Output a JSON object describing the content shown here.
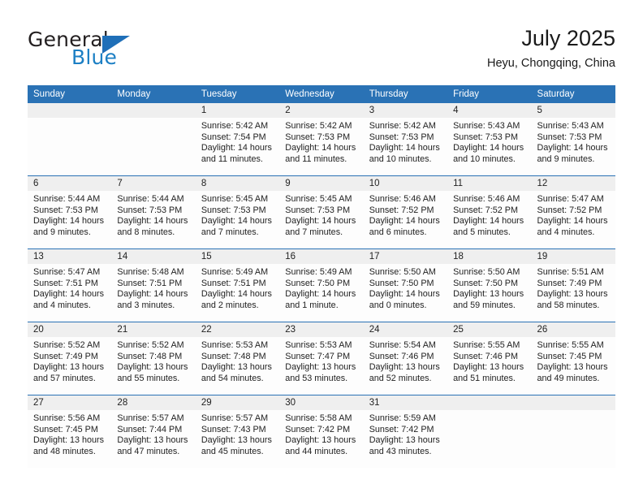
{
  "brand": {
    "name_part1": "General",
    "name_part2": "Blue"
  },
  "header": {
    "title": "July 2025",
    "subtitle": "Heyu, Chongqing, China"
  },
  "colors": {
    "header_blue": "#2a72b5",
    "logo_blue": "#1c7fc4",
    "daynum_band": "#efefef"
  },
  "weekday_headers": [
    "Sunday",
    "Monday",
    "Tuesday",
    "Wednesday",
    "Thursday",
    "Friday",
    "Saturday"
  ],
  "weeks": [
    [
      {
        "day": "",
        "sunrise": "",
        "sunset": "",
        "daylight_line1": "",
        "daylight_line2": "",
        "empty": true
      },
      {
        "day": "",
        "sunrise": "",
        "sunset": "",
        "daylight_line1": "",
        "daylight_line2": "",
        "empty": true
      },
      {
        "day": "1",
        "sunrise": "Sunrise: 5:42 AM",
        "sunset": "Sunset: 7:54 PM",
        "daylight_line1": "Daylight: 14 hours",
        "daylight_line2": "and 11 minutes."
      },
      {
        "day": "2",
        "sunrise": "Sunrise: 5:42 AM",
        "sunset": "Sunset: 7:53 PM",
        "daylight_line1": "Daylight: 14 hours",
        "daylight_line2": "and 11 minutes."
      },
      {
        "day": "3",
        "sunrise": "Sunrise: 5:42 AM",
        "sunset": "Sunset: 7:53 PM",
        "daylight_line1": "Daylight: 14 hours",
        "daylight_line2": "and 10 minutes."
      },
      {
        "day": "4",
        "sunrise": "Sunrise: 5:43 AM",
        "sunset": "Sunset: 7:53 PM",
        "daylight_line1": "Daylight: 14 hours",
        "daylight_line2": "and 10 minutes."
      },
      {
        "day": "5",
        "sunrise": "Sunrise: 5:43 AM",
        "sunset": "Sunset: 7:53 PM",
        "daylight_line1": "Daylight: 14 hours",
        "daylight_line2": "and 9 minutes."
      }
    ],
    [
      {
        "day": "6",
        "sunrise": "Sunrise: 5:44 AM",
        "sunset": "Sunset: 7:53 PM",
        "daylight_line1": "Daylight: 14 hours",
        "daylight_line2": "and 9 minutes."
      },
      {
        "day": "7",
        "sunrise": "Sunrise: 5:44 AM",
        "sunset": "Sunset: 7:53 PM",
        "daylight_line1": "Daylight: 14 hours",
        "daylight_line2": "and 8 minutes."
      },
      {
        "day": "8",
        "sunrise": "Sunrise: 5:45 AM",
        "sunset": "Sunset: 7:53 PM",
        "daylight_line1": "Daylight: 14 hours",
        "daylight_line2": "and 7 minutes."
      },
      {
        "day": "9",
        "sunrise": "Sunrise: 5:45 AM",
        "sunset": "Sunset: 7:53 PM",
        "daylight_line1": "Daylight: 14 hours",
        "daylight_line2": "and 7 minutes."
      },
      {
        "day": "10",
        "sunrise": "Sunrise: 5:46 AM",
        "sunset": "Sunset: 7:52 PM",
        "daylight_line1": "Daylight: 14 hours",
        "daylight_line2": "and 6 minutes."
      },
      {
        "day": "11",
        "sunrise": "Sunrise: 5:46 AM",
        "sunset": "Sunset: 7:52 PM",
        "daylight_line1": "Daylight: 14 hours",
        "daylight_line2": "and 5 minutes."
      },
      {
        "day": "12",
        "sunrise": "Sunrise: 5:47 AM",
        "sunset": "Sunset: 7:52 PM",
        "daylight_line1": "Daylight: 14 hours",
        "daylight_line2": "and 4 minutes."
      }
    ],
    [
      {
        "day": "13",
        "sunrise": "Sunrise: 5:47 AM",
        "sunset": "Sunset: 7:51 PM",
        "daylight_line1": "Daylight: 14 hours",
        "daylight_line2": "and 4 minutes."
      },
      {
        "day": "14",
        "sunrise": "Sunrise: 5:48 AM",
        "sunset": "Sunset: 7:51 PM",
        "daylight_line1": "Daylight: 14 hours",
        "daylight_line2": "and 3 minutes."
      },
      {
        "day": "15",
        "sunrise": "Sunrise: 5:49 AM",
        "sunset": "Sunset: 7:51 PM",
        "daylight_line1": "Daylight: 14 hours",
        "daylight_line2": "and 2 minutes."
      },
      {
        "day": "16",
        "sunrise": "Sunrise: 5:49 AM",
        "sunset": "Sunset: 7:50 PM",
        "daylight_line1": "Daylight: 14 hours",
        "daylight_line2": "and 1 minute."
      },
      {
        "day": "17",
        "sunrise": "Sunrise: 5:50 AM",
        "sunset": "Sunset: 7:50 PM",
        "daylight_line1": "Daylight: 14 hours",
        "daylight_line2": "and 0 minutes."
      },
      {
        "day": "18",
        "sunrise": "Sunrise: 5:50 AM",
        "sunset": "Sunset: 7:50 PM",
        "daylight_line1": "Daylight: 13 hours",
        "daylight_line2": "and 59 minutes."
      },
      {
        "day": "19",
        "sunrise": "Sunrise: 5:51 AM",
        "sunset": "Sunset: 7:49 PM",
        "daylight_line1": "Daylight: 13 hours",
        "daylight_line2": "and 58 minutes."
      }
    ],
    [
      {
        "day": "20",
        "sunrise": "Sunrise: 5:52 AM",
        "sunset": "Sunset: 7:49 PM",
        "daylight_line1": "Daylight: 13 hours",
        "daylight_line2": "and 57 minutes."
      },
      {
        "day": "21",
        "sunrise": "Sunrise: 5:52 AM",
        "sunset": "Sunset: 7:48 PM",
        "daylight_line1": "Daylight: 13 hours",
        "daylight_line2": "and 55 minutes."
      },
      {
        "day": "22",
        "sunrise": "Sunrise: 5:53 AM",
        "sunset": "Sunset: 7:48 PM",
        "daylight_line1": "Daylight: 13 hours",
        "daylight_line2": "and 54 minutes."
      },
      {
        "day": "23",
        "sunrise": "Sunrise: 5:53 AM",
        "sunset": "Sunset: 7:47 PM",
        "daylight_line1": "Daylight: 13 hours",
        "daylight_line2": "and 53 minutes."
      },
      {
        "day": "24",
        "sunrise": "Sunrise: 5:54 AM",
        "sunset": "Sunset: 7:46 PM",
        "daylight_line1": "Daylight: 13 hours",
        "daylight_line2": "and 52 minutes."
      },
      {
        "day": "25",
        "sunrise": "Sunrise: 5:55 AM",
        "sunset": "Sunset: 7:46 PM",
        "daylight_line1": "Daylight: 13 hours",
        "daylight_line2": "and 51 minutes."
      },
      {
        "day": "26",
        "sunrise": "Sunrise: 5:55 AM",
        "sunset": "Sunset: 7:45 PM",
        "daylight_line1": "Daylight: 13 hours",
        "daylight_line2": "and 49 minutes."
      }
    ],
    [
      {
        "day": "27",
        "sunrise": "Sunrise: 5:56 AM",
        "sunset": "Sunset: 7:45 PM",
        "daylight_line1": "Daylight: 13 hours",
        "daylight_line2": "and 48 minutes."
      },
      {
        "day": "28",
        "sunrise": "Sunrise: 5:57 AM",
        "sunset": "Sunset: 7:44 PM",
        "daylight_line1": "Daylight: 13 hours",
        "daylight_line2": "and 47 minutes."
      },
      {
        "day": "29",
        "sunrise": "Sunrise: 5:57 AM",
        "sunset": "Sunset: 7:43 PM",
        "daylight_line1": "Daylight: 13 hours",
        "daylight_line2": "and 45 minutes."
      },
      {
        "day": "30",
        "sunrise": "Sunrise: 5:58 AM",
        "sunset": "Sunset: 7:42 PM",
        "daylight_line1": "Daylight: 13 hours",
        "daylight_line2": "and 44 minutes."
      },
      {
        "day": "31",
        "sunrise": "Sunrise: 5:59 AM",
        "sunset": "Sunset: 7:42 PM",
        "daylight_line1": "Daylight: 13 hours",
        "daylight_line2": "and 43 minutes."
      },
      {
        "day": "",
        "sunrise": "",
        "sunset": "",
        "daylight_line1": "",
        "daylight_line2": "",
        "empty": true
      },
      {
        "day": "",
        "sunrise": "",
        "sunset": "",
        "daylight_line1": "",
        "daylight_line2": "",
        "empty": true
      }
    ]
  ]
}
